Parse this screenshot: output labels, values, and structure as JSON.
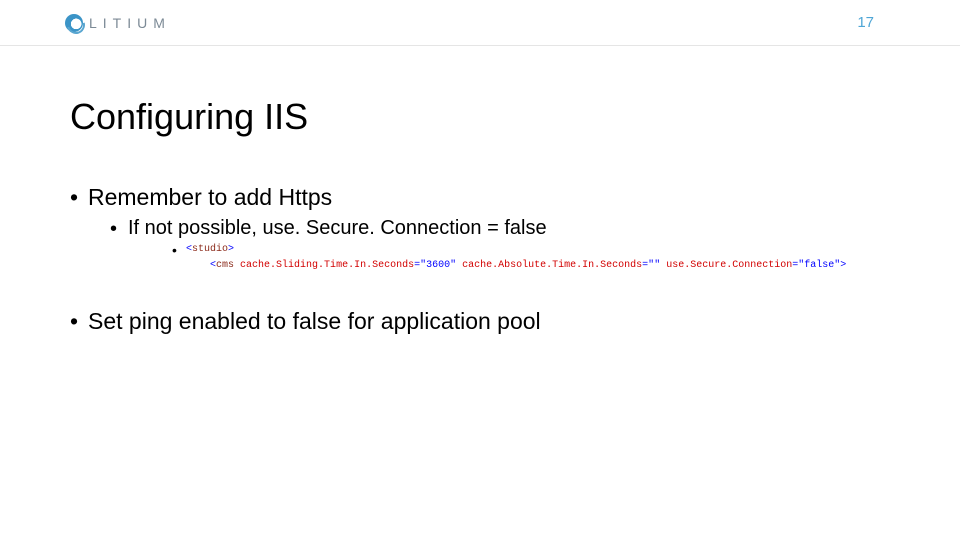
{
  "header": {
    "brand": "LITIUM",
    "page_number": "17"
  },
  "title": "Configuring IIS",
  "bullets": {
    "remember_https": "Remember to add Https",
    "if_not_possible": "If not possible, use. Secure. Connection = false",
    "set_ping": "Set ping enabled to false for application pool"
  },
  "code": {
    "lt1": "<",
    "studio": "studio",
    "gt1": ">",
    "lt2": "<",
    "cms": "cms",
    "sp": " ",
    "attr1": "cache.Sliding.Time.In.Seconds",
    "eq": "=\"",
    "val1": "3600",
    "q": "\"",
    "attr2": "cache.Absolute.Time.In.Seconds",
    "val2": "",
    "attr3": "use.Secure.Connection",
    "val3": "false",
    "gt2": ">"
  }
}
